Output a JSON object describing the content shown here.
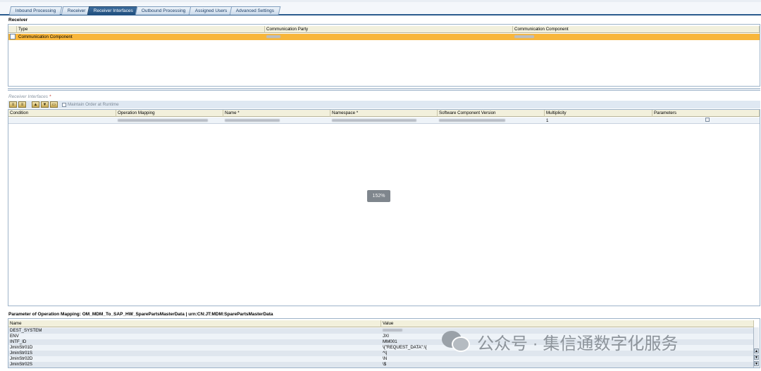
{
  "tabs": [
    {
      "label": "Inbound Processing"
    },
    {
      "label": "Receiver"
    },
    {
      "label": "Receiver Interfaces",
      "active": true
    },
    {
      "label": "Outbound Processing"
    },
    {
      "label": "Assigned Users"
    },
    {
      "label": "Advanced Settings"
    }
  ],
  "receiver": {
    "title": "Receiver",
    "columns": [
      "Type",
      "Communication Party",
      "Communication Component"
    ],
    "rows": [
      {
        "type": "Communication Component"
      }
    ]
  },
  "receiver_interfaces": {
    "title": "Receiver Interfaces",
    "required_mark": "*",
    "maintain_order_label": "Maintain Order at Runtime",
    "columns": [
      "Condition",
      "Operation Mapping",
      "Name *",
      "Namespace *",
      "Software Component Version",
      "Multiplicity",
      "Parameters"
    ],
    "rows": [
      {
        "multiplicity": "1"
      }
    ]
  },
  "zoom": "152%",
  "params": {
    "title": "Parameter of Operation Mapping: OM_MDM_To_SAP_HW_SparePartsMasterData | urn:CN:JT:MDM:SparePartsMasterData",
    "columns": [
      "Name",
      "Value"
    ],
    "rows": [
      {
        "name": "DEST_SYSTEM",
        "value": ""
      },
      {
        "name": "ENV",
        "value": "JXI"
      },
      {
        "name": "INTF_ID",
        "value": "MM001"
      },
      {
        "name": "JminStr01D",
        "value": "\\{\"REQUEST_DATA\":\\{"
      },
      {
        "name": "JminStr01S",
        "value": "^\\|"
      },
      {
        "name": "JminStr02D",
        "value": "\\N"
      },
      {
        "name": "JminStr02S",
        "value": "\\$"
      }
    ]
  },
  "watermark": "公众号 · 集信通数字化服务"
}
